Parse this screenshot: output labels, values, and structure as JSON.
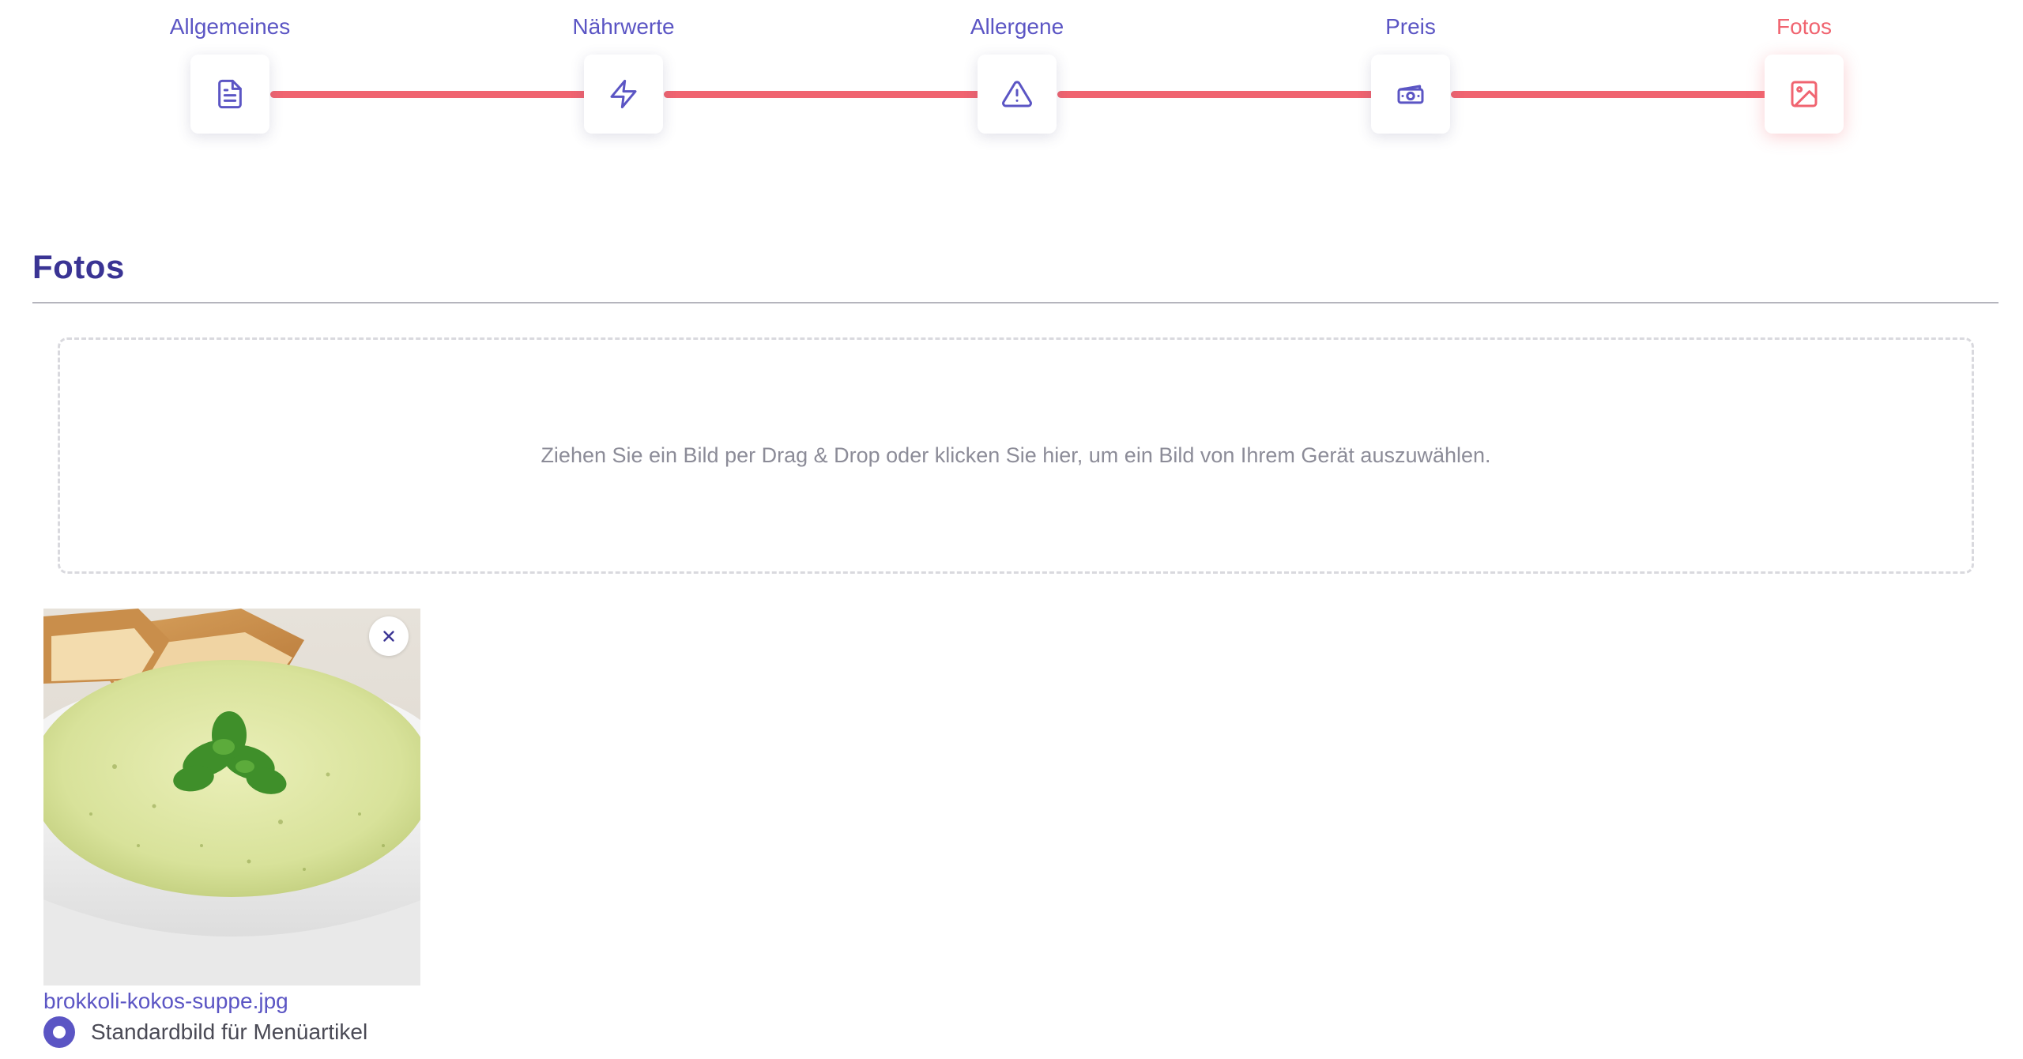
{
  "colors": {
    "primary": "#5b55c4",
    "accent": "#f06470",
    "heading": "#3a3494",
    "muted": "#8c8c98",
    "text": "#4a4a55"
  },
  "stepper": {
    "steps": [
      {
        "label": "Allgemeines",
        "icon": "document-icon",
        "state": "completed"
      },
      {
        "label": "Nährwerte",
        "icon": "lightning-icon",
        "state": "completed"
      },
      {
        "label": "Allergene",
        "icon": "warning-icon",
        "state": "completed"
      },
      {
        "label": "Preis",
        "icon": "money-icon",
        "state": "completed"
      },
      {
        "label": "Fotos",
        "icon": "image-icon",
        "state": "active"
      }
    ]
  },
  "section": {
    "title": "Fotos"
  },
  "dropzone": {
    "text": "Ziehen Sie ein Bild per Drag & Drop oder klicken Sie hier, um ein Bild von Ihrem Gerät auszuwählen."
  },
  "photos": [
    {
      "file_name": "brokkoli-kokos-suppe.jpg",
      "default_label": "Standardbild für Menüartikel",
      "is_default": true,
      "remove_icon": "close-icon",
      "image": "broccoli-coconut-soup-bowl-photo"
    }
  ]
}
